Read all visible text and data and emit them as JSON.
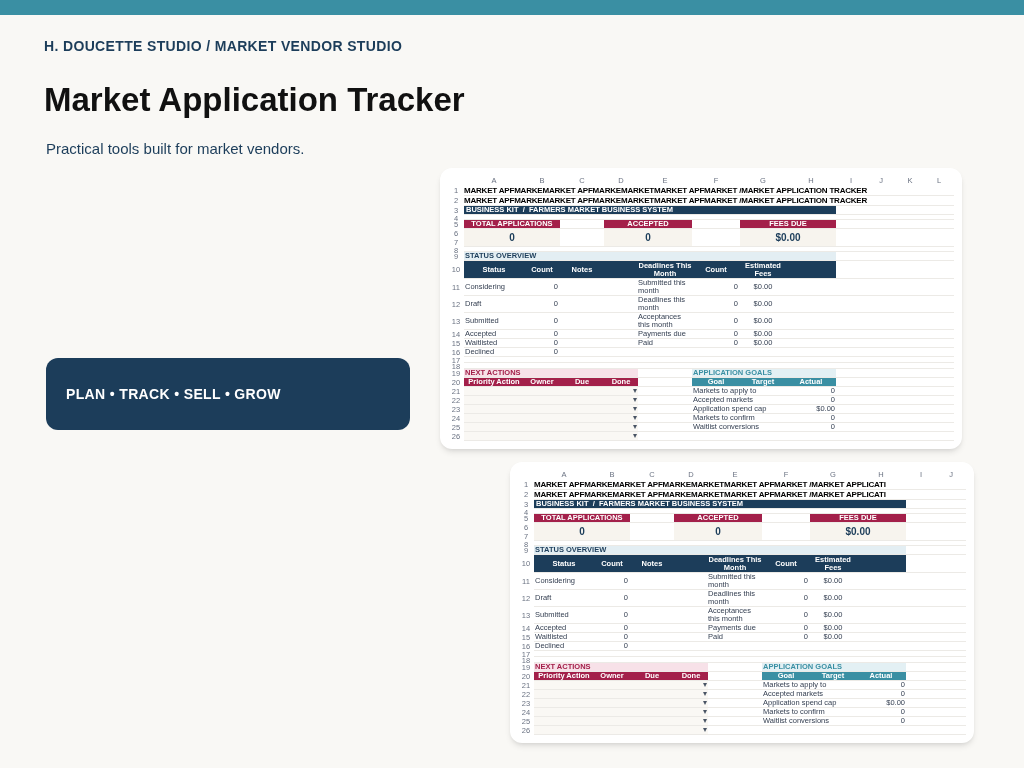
{
  "brand": "H. DOUCETTE STUDIO / MARKET VENDOR STUDIO",
  "title": "Market Application Tracker",
  "subtitle": "Practical tools built for market vendors.",
  "tagline": "PLAN • TRACK • SELL • GROW",
  "sheets": [
    {
      "column_letters": [
        "A",
        "B",
        "C",
        "D",
        "E",
        "F",
        "G",
        "H",
        "I",
        "J",
        "K",
        "L"
      ],
      "row_numbers": [
        "1",
        "2",
        "3",
        "4",
        "5",
        "6",
        "7",
        "8",
        "9",
        "10",
        "11",
        "12",
        "13",
        "14",
        "15",
        "16",
        "17",
        "18",
        "19",
        "20",
        "21",
        "22",
        "23",
        "24",
        "25",
        "26"
      ],
      "title_lines": [
        "MARKET APFMARKEMARKET APFMARKEMARKETMARKET APFMARKET /MARKET APPLICATION TRACKER",
        "MARKET APFMARKEMARKET APFMARKEMARKETMARKET APFMARKET /MARKET APPLICATION TRACKER"
      ],
      "kit_bar": "BUSINESS KIT  /  FARMERS MARKET BUSINESS SYSTEM",
      "kpis": [
        {
          "label": "TOTAL APPLICATIONS",
          "value": "0"
        },
        {
          "label": "ACCEPTED",
          "value": "0"
        },
        {
          "label": "FEES DUE",
          "value": "$0.00"
        }
      ],
      "status_overview": {
        "title": "STATUS OVERVIEW",
        "columns": [
          "Status",
          "Count",
          "Notes",
          "Deadlines This Month",
          "Count",
          "Estimated Fees"
        ],
        "rows": [
          {
            "status": "Considering",
            "count": "0",
            "deadline": "Submitted this month",
            "deadline_count": "0",
            "fees": "$0.00"
          },
          {
            "status": "Draft",
            "count": "0",
            "deadline": "Deadlines this month",
            "deadline_count": "0",
            "fees": "$0.00"
          },
          {
            "status": "Submitted",
            "count": "0",
            "deadline": "Acceptances this month",
            "deadline_count": "0",
            "fees": "$0.00"
          },
          {
            "status": "Accepted",
            "count": "0",
            "deadline": "Payments due",
            "deadline_count": "0",
            "fees": "$0.00"
          },
          {
            "status": "Waitlisted",
            "count": "0",
            "deadline": "Paid",
            "deadline_count": "0",
            "fees": "$0.00"
          },
          {
            "status": "Declined",
            "count": "0"
          }
        ]
      },
      "next_actions": {
        "title": "NEXT ACTIONS",
        "columns": [
          "Priority Action",
          "Owner",
          "Due",
          "Done"
        ],
        "rows": [
          {
            "done": "▾"
          },
          {
            "done": "▾"
          },
          {
            "done": "▾"
          },
          {
            "done": "▾"
          },
          {
            "done": "▾"
          },
          {
            "done": "▾"
          }
        ]
      },
      "goals": {
        "title": "APPLICATION GOALS",
        "columns": [
          "Goal",
          "Target",
          "Actual"
        ],
        "rows": [
          {
            "goal": "Markets to apply to",
            "actual": "0"
          },
          {
            "goal": "Accepted markets",
            "actual": "0"
          },
          {
            "goal": "Application spend cap",
            "actual": "$0.00"
          },
          {
            "goal": "Markets to confirm",
            "actual": "0"
          },
          {
            "goal": "Waitlist conversions",
            "actual": "0"
          }
        ]
      }
    },
    {
      "column_letters": [
        "A",
        "B",
        "C",
        "D",
        "E",
        "F",
        "G",
        "H",
        "I",
        "J"
      ],
      "row_numbers": [
        "1",
        "2",
        "3",
        "4",
        "5",
        "6",
        "7",
        "8",
        "9",
        "10",
        "11",
        "12",
        "13",
        "14",
        "15",
        "16",
        "17",
        "18",
        "19",
        "20",
        "21",
        "22",
        "23",
        "24",
        "25",
        "26"
      ],
      "title_lines": [
        "MARKET APFMARKEMARKET APFMARKEMARKETMARKET APFMARKET /MARKET APPLICATI",
        "MARKET APFMARKEMARKET APFMARKEMARKETMARKET APFMARKET /MARKET APPLICATI"
      ],
      "kit_bar": "BUSINESS KIT  /  FARMERS MARKET BUSINESS SYSTEM",
      "kpis": [
        {
          "label": "TOTAL APPLICATIONS",
          "value": "0"
        },
        {
          "label": "ACCEPTED",
          "value": "0"
        },
        {
          "label": "FEES DUE",
          "value": "$0.00"
        }
      ],
      "status_overview": {
        "title": "STATUS OVERVIEW",
        "columns": [
          "Status",
          "Count",
          "Notes",
          "Deadlines This Month",
          "Count",
          "Estimated Fees"
        ],
        "rows": [
          {
            "status": "Considering",
            "count": "0",
            "deadline": "Submitted this month",
            "deadline_count": "0",
            "fees": "$0.00"
          },
          {
            "status": "Draft",
            "count": "0",
            "deadline": "Deadlines this month",
            "deadline_count": "0",
            "fees": "$0.00"
          },
          {
            "status": "Submitted",
            "count": "0",
            "deadline": "Acceptances this month",
            "deadline_count": "0",
            "fees": "$0.00"
          },
          {
            "status": "Accepted",
            "count": "0",
            "deadline": "Payments due",
            "deadline_count": "0",
            "fees": "$0.00"
          },
          {
            "status": "Waitlisted",
            "count": "0",
            "deadline": "Paid",
            "deadline_count": "0",
            "fees": "$0.00"
          },
          {
            "status": "Declined",
            "count": "0"
          }
        ]
      },
      "next_actions": {
        "title": "NEXT ACTIONS",
        "columns": [
          "Priority Action",
          "Owner",
          "Due",
          "Done"
        ],
        "rows": [
          {
            "done": "▾"
          },
          {
            "done": "▾"
          },
          {
            "done": "▾"
          },
          {
            "done": "▾"
          },
          {
            "done": "▾"
          },
          {
            "done": "▾"
          }
        ]
      },
      "goals": {
        "title": "APPLICATION GOALS",
        "columns": [
          "Goal",
          "Target",
          "Actual"
        ],
        "rows": [
          {
            "goal": "Markets to apply to",
            "actual": "0"
          },
          {
            "goal": "Accepted markets",
            "actual": "0"
          },
          {
            "goal": "Application spend cap",
            "actual": "$0.00"
          },
          {
            "goal": "Markets to confirm",
            "actual": "0"
          },
          {
            "goal": "Waitlist conversions",
            "actual": "0"
          }
        ]
      }
    }
  ]
}
